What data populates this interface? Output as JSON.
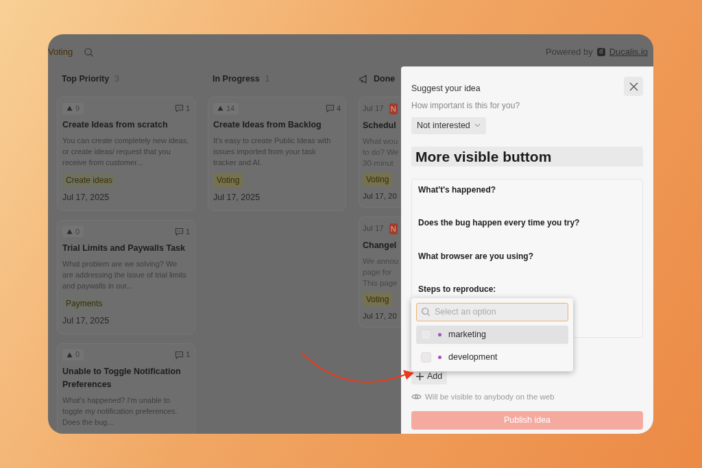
{
  "header": {
    "tab": "Voting",
    "powered_by": "Powered by",
    "brand_logo": "d",
    "brand_link": "Ducalis.io"
  },
  "columns": [
    {
      "title": "Top Priority",
      "count": "3",
      "kind": "full",
      "cards": [
        {
          "votes": "9",
          "comments": "1",
          "title": "Create Ideas from scratch",
          "description": "You can create completely new ideas, or create ideas/ request that you receive from customer...",
          "tag": {
            "label": "Create ideas",
            "color": "#6e7160"
          },
          "date": "Jul 17, 2025"
        },
        {
          "votes": "0",
          "comments": "1",
          "title": "Trial Limits and Paywalls Task",
          "description": "What problem are we solving? We are addressing the issue of trial limits and paywalls in our...",
          "tag": {
            "label": "Payments",
            "color": "#6c706a"
          },
          "date": "Jul 17, 2025"
        },
        {
          "votes": "0",
          "comments": "1",
          "title": "Unable to Toggle Notification Preferences",
          "description": "What's happened? I'm unable to toggle my notification preferences. Does the bug..."
        }
      ]
    },
    {
      "title": "In Progress",
      "count": "1",
      "kind": "full",
      "cards": [
        {
          "votes": "14",
          "comments": "4",
          "title": "Create Ideas from Backlog",
          "description": "It's easy to create Public Ideas with issues imported from your task tracker and AI.",
          "tag": {
            "label": "Voting",
            "color": "#76724f"
          },
          "date": "Jul 17, 2025"
        }
      ]
    },
    {
      "title": "Done",
      "kind": "cut",
      "cards": [
        {
          "date_short": "Jul 17",
          "badge": "N",
          "title": "Schedul",
          "lines": [
            "What wou",
            "to do? We",
            "30-minut"
          ],
          "tag": {
            "label": "Voting",
            "color": "#76724f"
          },
          "date": "Jul 17, 20"
        },
        {
          "date_short": "Jul 17",
          "badge": "N",
          "title": "Changel",
          "lines": [
            "We annou",
            "page for",
            "This page"
          ],
          "tag": {
            "label": "Voting",
            "color": "#76724f"
          },
          "date": "Jul 17, 20"
        }
      ]
    }
  ],
  "panel": {
    "heading": "Suggest your idea",
    "importance_label": "How important is this for you?",
    "importance_value": "Not interested",
    "title_value": "More visible buttom",
    "editor_lines": [
      "What't's happened?",
      "Does the bug happen every time you try?",
      "What browser are you using?",
      "Steps to reproduce:"
    ],
    "dropdown": {
      "placeholder": "Select an option",
      "options": [
        {
          "label": "marketing",
          "highlighted": true,
          "checked": false
        },
        {
          "label": "development",
          "highlighted": false,
          "checked": false
        }
      ]
    },
    "add_button": "Add",
    "visibility_note": "Will be visible to anybody on the web",
    "publish_button": "Publish idea"
  }
}
